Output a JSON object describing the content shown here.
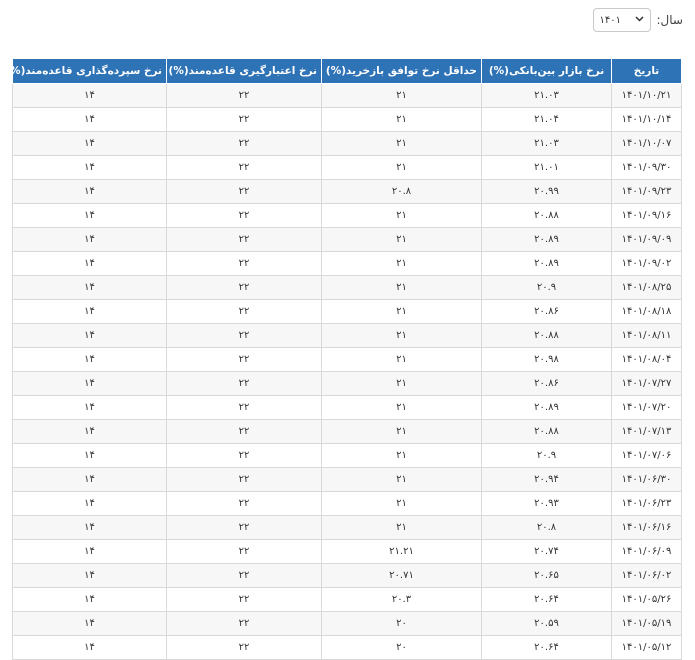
{
  "filter": {
    "label": "سال:",
    "selected_year": "۱۴۰۱"
  },
  "table": {
    "headers": [
      "تاریخ",
      "نرخ بازار بین‌بانکی(%)",
      "حداقل نرخ توافق بازخرید(%)",
      "نرخ اعتبارگیری قاعده‌مند(%)",
      "نرخ سپرده‌گذاری قاعده‌مند(%)"
    ],
    "rows": [
      [
        "۱۴۰۱/۱۰/۲۱",
        "۲۱.۰۳",
        "۲۱",
        "۲۲",
        "۱۴"
      ],
      [
        "۱۴۰۱/۱۰/۱۴",
        "۲۱.۰۴",
        "۲۱",
        "۲۲",
        "۱۴"
      ],
      [
        "۱۴۰۱/۱۰/۰۷",
        "۲۱.۰۳",
        "۲۱",
        "۲۲",
        "۱۴"
      ],
      [
        "۱۴۰۱/۰۹/۳۰",
        "۲۱.۰۱",
        "۲۱",
        "۲۲",
        "۱۴"
      ],
      [
        "۱۴۰۱/۰۹/۲۳",
        "۲۰.۹۹",
        "۲۰.۸",
        "۲۲",
        "۱۴"
      ],
      [
        "۱۴۰۱/۰۹/۱۶",
        "۲۰.۸۸",
        "۲۱",
        "۲۲",
        "۱۴"
      ],
      [
        "۱۴۰۱/۰۹/۰۹",
        "۲۰.۸۹",
        "۲۱",
        "۲۲",
        "۱۴"
      ],
      [
        "۱۴۰۱/۰۹/۰۲",
        "۲۰.۸۹",
        "۲۱",
        "۲۲",
        "۱۴"
      ],
      [
        "۱۴۰۱/۰۸/۲۵",
        "۲۰.۹",
        "۲۱",
        "۲۲",
        "۱۴"
      ],
      [
        "۱۴۰۱/۰۸/۱۸",
        "۲۰.۸۶",
        "۲۱",
        "۲۲",
        "۱۴"
      ],
      [
        "۱۴۰۱/۰۸/۱۱",
        "۲۰.۸۸",
        "۲۱",
        "۲۲",
        "۱۴"
      ],
      [
        "۱۴۰۱/۰۸/۰۴",
        "۲۰.۹۸",
        "۲۱",
        "۲۲",
        "۱۴"
      ],
      [
        "۱۴۰۱/۰۷/۲۷",
        "۲۰.۸۶",
        "۲۱",
        "۲۲",
        "۱۴"
      ],
      [
        "۱۴۰۱/۰۷/۲۰",
        "۲۰.۸۹",
        "۲۱",
        "۲۲",
        "۱۴"
      ],
      [
        "۱۴۰۱/۰۷/۱۳",
        "۲۰.۸۸",
        "۲۱",
        "۲۲",
        "۱۴"
      ],
      [
        "۱۴۰۱/۰۷/۰۶",
        "۲۰.۹",
        "۲۱",
        "۲۲",
        "۱۴"
      ],
      [
        "۱۴۰۱/۰۶/۳۰",
        "۲۰.۹۴",
        "۲۱",
        "۲۲",
        "۱۴"
      ],
      [
        "۱۴۰۱/۰۶/۲۳",
        "۲۰.۹۳",
        "۲۱",
        "۲۲",
        "۱۴"
      ],
      [
        "۱۴۰۱/۰۶/۱۶",
        "۲۰.۸",
        "۲۱",
        "۲۲",
        "۱۴"
      ],
      [
        "۱۴۰۱/۰۶/۰۹",
        "۲۰.۷۴",
        "۲۱.۲۱",
        "۲۲",
        "۱۴"
      ],
      [
        "۱۴۰۱/۰۶/۰۲",
        "۲۰.۶۵",
        "۲۰.۷۱",
        "۲۲",
        "۱۴"
      ],
      [
        "۱۴۰۱/۰۵/۲۶",
        "۲۰.۶۴",
        "۲۰.۳",
        "۲۲",
        "۱۴"
      ],
      [
        "۱۴۰۱/۰۵/۱۹",
        "۲۰.۵۹",
        "۲۰",
        "۲۲",
        "۱۴"
      ],
      [
        "۱۴۰۱/۰۵/۱۲",
        "۲۰.۶۴",
        "۲۰",
        "۲۲",
        "۱۴"
      ]
    ]
  }
}
